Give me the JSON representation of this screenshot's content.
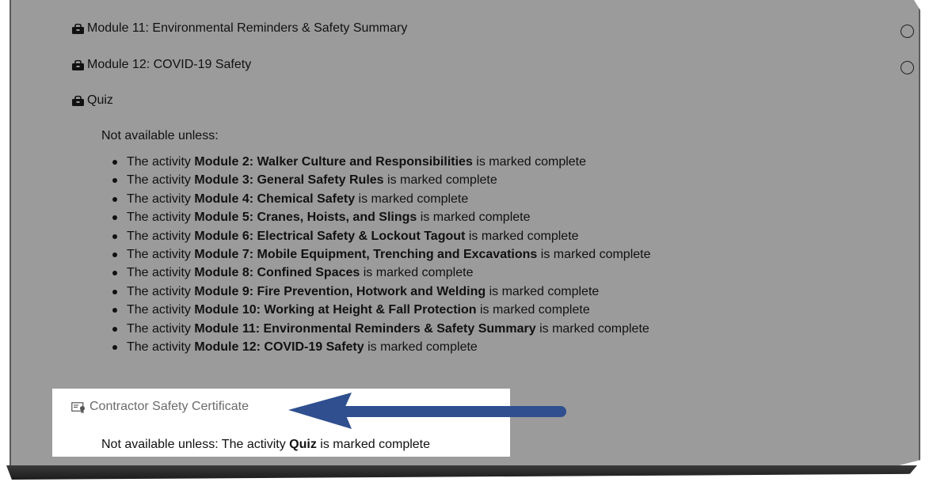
{
  "modules": [
    {
      "label": "Module 11: Environmental Reminders & Safety Summary",
      "icon": "lock-icon",
      "has_completion": true
    },
    {
      "label": "Module 12: COVID-19 Safety",
      "icon": "lock-icon",
      "has_completion": true
    },
    {
      "label": "Quiz",
      "icon": "lock-icon",
      "has_completion": false
    }
  ],
  "quiz_restriction": {
    "heading": "Not available unless:",
    "prefix": "The activity",
    "suffix": "is marked complete",
    "conditions": [
      "Module 2: Walker Culture and Responsibilities",
      "Module 3: General Safety Rules",
      "Module 4: Chemical Safety",
      "Module 5: Cranes, Hoists, and Slings",
      "Module 6: Electrical Safety & Lockout Tagout",
      "Module 7: Mobile Equipment, Trenching and Excavations",
      "Module 8: Confined Spaces",
      "Module 9: Fire Prevention, Hotwork and Welding",
      "Module 10: Working at Height & Fall Protection",
      "Module 11: Environmental Reminders & Safety Summary",
      "Module 12: COVID-19 Safety"
    ]
  },
  "certificate": {
    "label": "Contractor Safety Certificate",
    "icon": "certificate-icon",
    "restriction_prefix": "Not available unless: The activity",
    "restriction_activity": "Quiz",
    "restriction_suffix": "is marked complete"
  },
  "colors": {
    "panel_bg": "#9b9b9b",
    "highlight_bg": "#ffffff",
    "arrow": "#2f4f8f"
  }
}
